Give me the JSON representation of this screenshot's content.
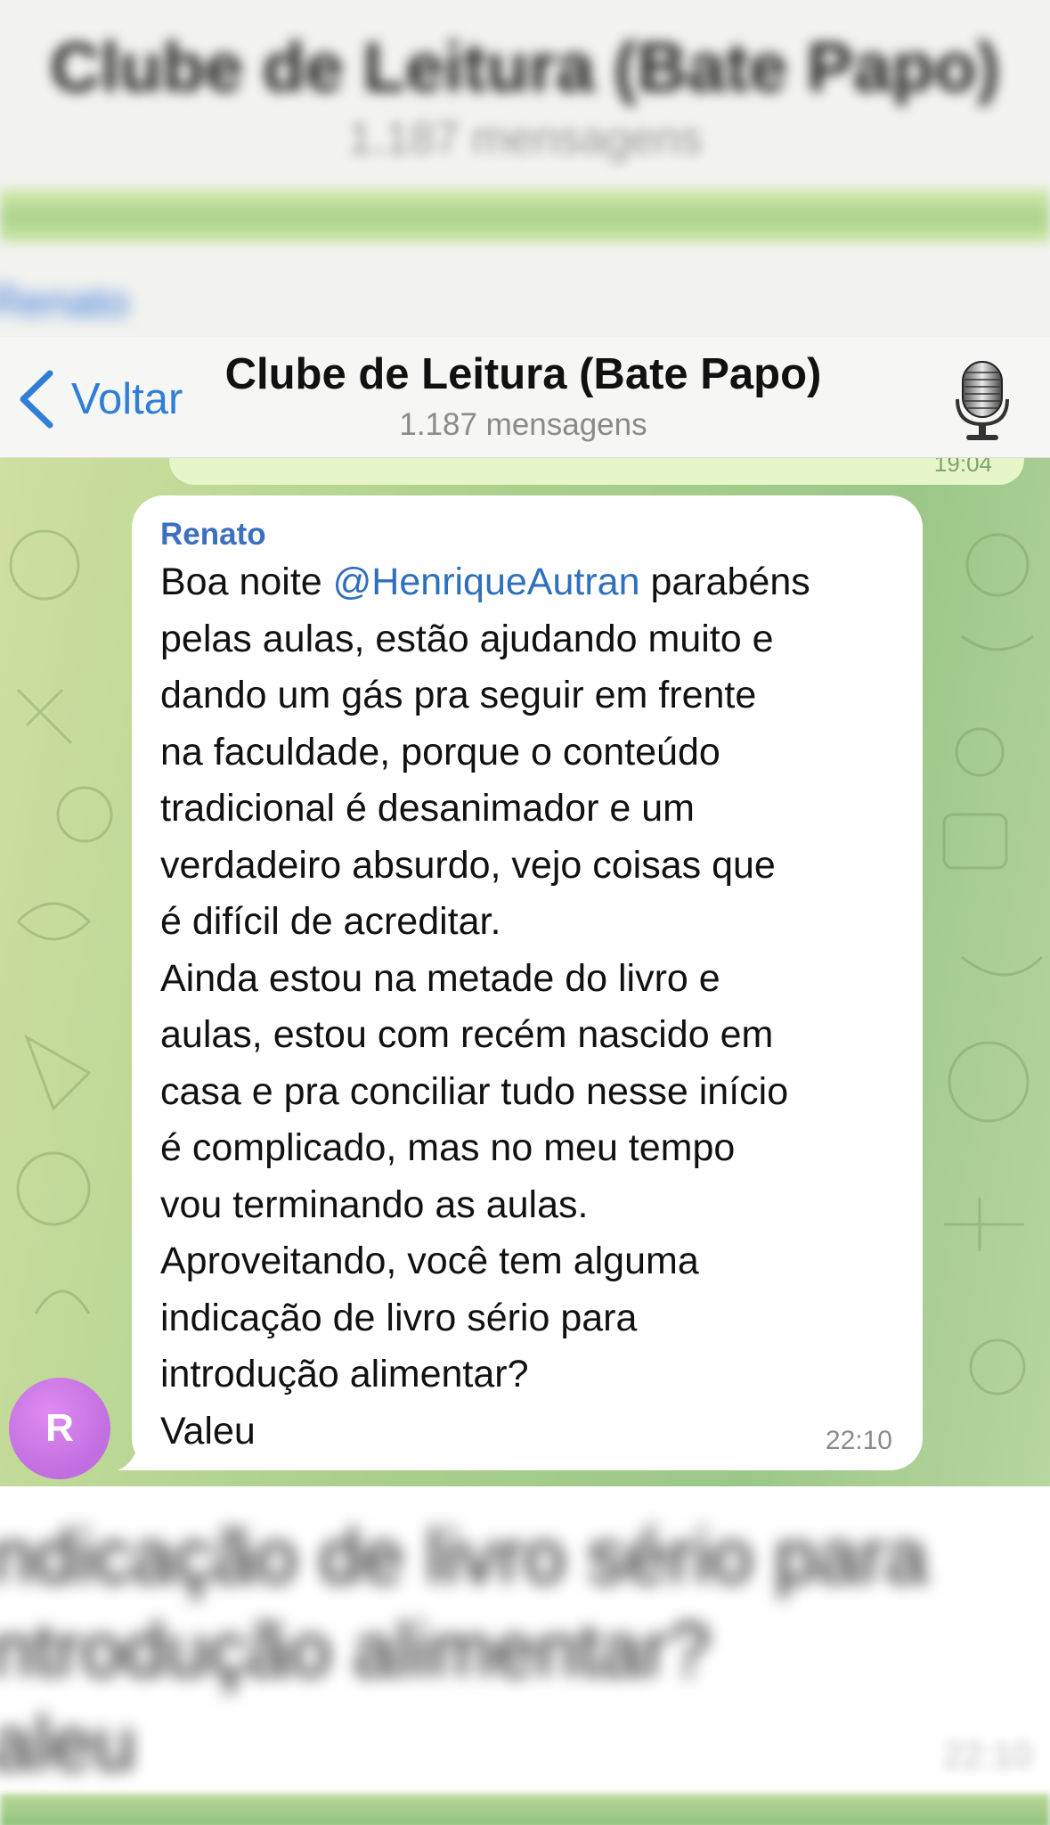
{
  "backdrop": {
    "top_title": "Clube de Leitura (Bate Papo)",
    "top_subtitle": "1.187 mensagens",
    "top_link": "Renato",
    "bottom_lines": [
      "ndicação de livro sério para",
      "ntrodução alimentar?",
      "aleu"
    ],
    "bottom_time": "22:10"
  },
  "header": {
    "back_label": "Voltar",
    "title": "Clube de Leitura (Bate Papo)",
    "subtitle": "1.187 mensagens",
    "right_icon": "microphone-icon"
  },
  "chat": {
    "previous_bubble_time": "19:04"
  },
  "message": {
    "sender": "Renato",
    "mention": "@HenriqueAutran",
    "first_line_before": "Boa noite ",
    "first_line_after": " parabéns",
    "lines": [
      "pelas aulas, estão ajudando muito e",
      "dando um gás pra seguir em frente",
      "na faculdade, porque o conteúdo",
      "tradicional é desanimador e um",
      "verdadeiro absurdo,  vejo coisas que",
      "é difícil de acreditar.",
      "Ainda estou na metade do livro e",
      "aulas, estou com recém nascido em",
      "casa e pra conciliar tudo nesse início",
      "é complicado,  mas no meu tempo",
      "vou terminando as aulas.",
      "Aproveitando,  você tem alguma",
      "indicação de livro sério para",
      "introdução alimentar?",
      "Valeu"
    ],
    "time": "22:10",
    "avatar_initial": "R"
  },
  "colors": {
    "accent": "#2f7fd6",
    "sender": "#3b6fbf",
    "avatar": "#c96fe6"
  }
}
